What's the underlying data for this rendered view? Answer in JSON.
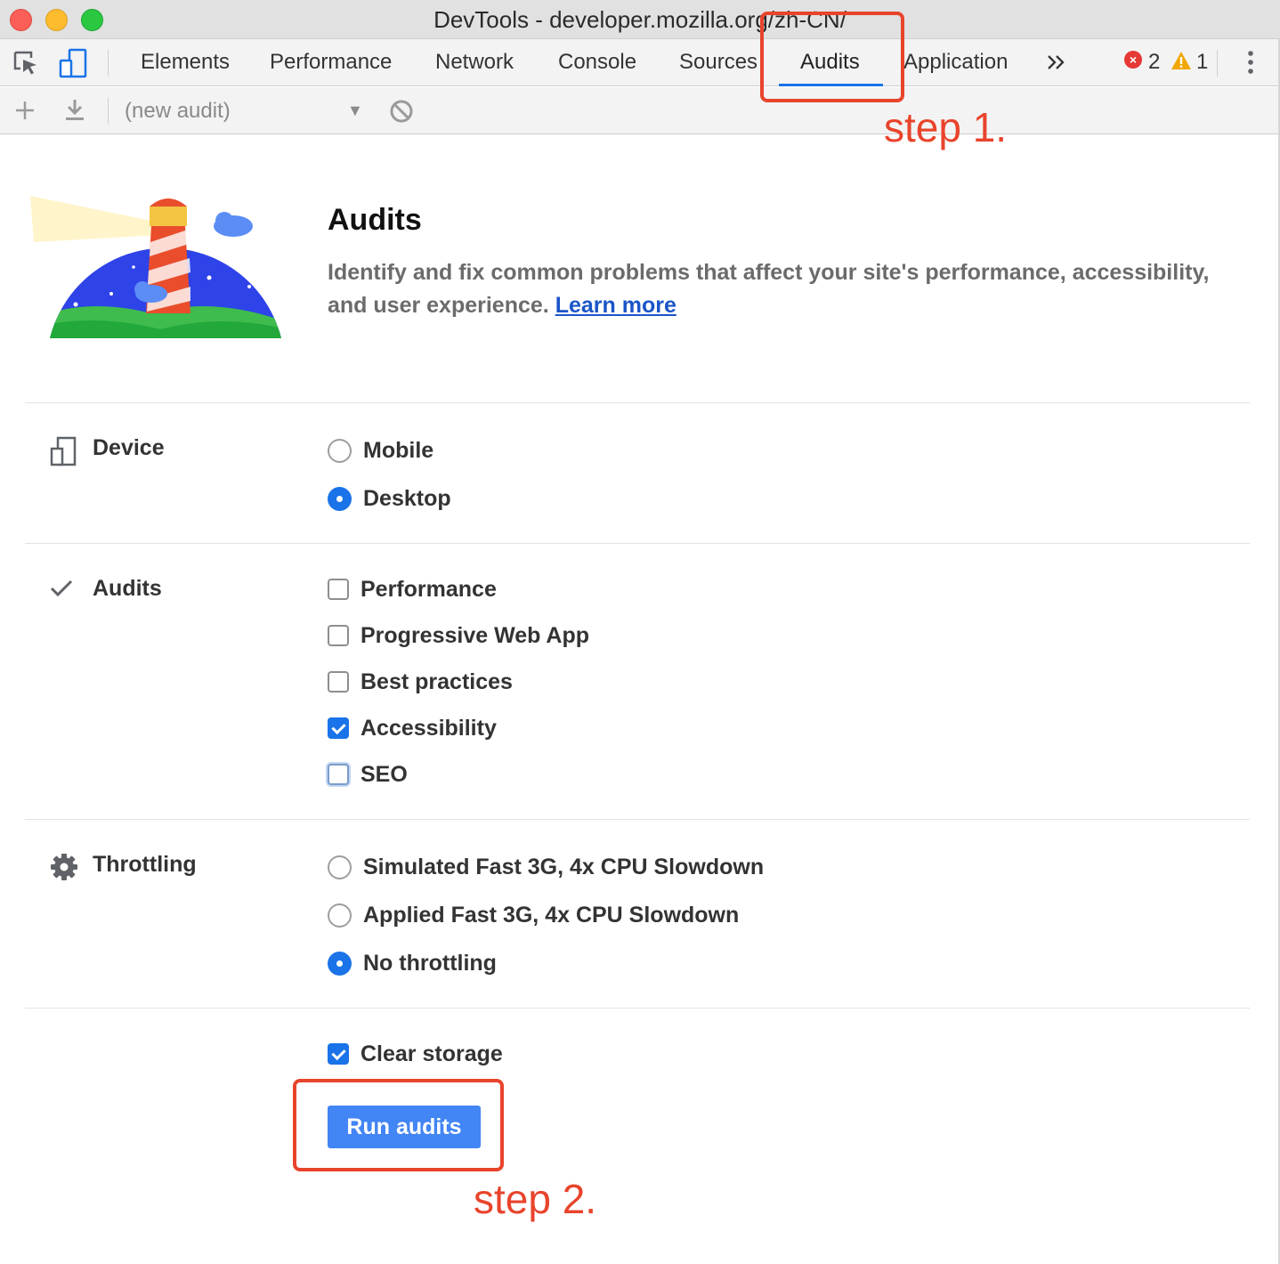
{
  "window": {
    "title": "DevTools - developer.mozilla.org/zh-CN/"
  },
  "tabs": [
    {
      "label": "Elements"
    },
    {
      "label": "Performance"
    },
    {
      "label": "Network"
    },
    {
      "label": "Console"
    },
    {
      "label": "Sources"
    },
    {
      "label": "Audits",
      "active": true
    },
    {
      "label": "Application"
    }
  ],
  "status": {
    "errors": "2",
    "warnings": "1",
    "error_color": "#e53935",
    "warning_color": "#f2a600"
  },
  "toolbar": {
    "audit_select": "(new audit)"
  },
  "header": {
    "title": "Audits",
    "description": "Identify and fix common problems that affect your site's performance, accessibility, and user experience.",
    "learn_more": "Learn more"
  },
  "sections": {
    "device": {
      "label": "Device",
      "options": [
        {
          "label": "Mobile",
          "selected": false
        },
        {
          "label": "Desktop",
          "selected": true
        }
      ]
    },
    "audits": {
      "label": "Audits",
      "options": [
        {
          "label": "Performance",
          "checked": false
        },
        {
          "label": "Progressive Web App",
          "checked": false
        },
        {
          "label": "Best practices",
          "checked": false
        },
        {
          "label": "Accessibility",
          "checked": true
        },
        {
          "label": "SEO",
          "checked": false
        }
      ]
    },
    "throttling": {
      "label": "Throttling",
      "options": [
        {
          "label": "Simulated Fast 3G, 4x CPU Slowdown",
          "selected": false
        },
        {
          "label": "Applied Fast 3G, 4x CPU Slowdown",
          "selected": false
        },
        {
          "label": "No throttling",
          "selected": true
        }
      ]
    },
    "clear_storage": {
      "label": "Clear storage",
      "checked": true
    }
  },
  "run_button": "Run audits",
  "annotations": {
    "step1": "step 1.",
    "step2": "step 2.",
    "color": "#e8442c"
  },
  "accent_color": "#1a73e8"
}
